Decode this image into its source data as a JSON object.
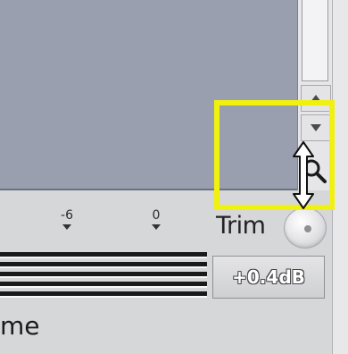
{
  "meter": {
    "tick_labels": [
      "-6",
      "0"
    ]
  },
  "trim": {
    "label": "Trim",
    "value": "+0.4dB"
  },
  "volume": {
    "label_fragment": "me"
  },
  "colors": {
    "highlight": "#f1f10f",
    "track_background": "#9a9fb0"
  },
  "icons": {
    "scroll_up": "triangle-up-icon",
    "scroll_down": "triangle-down-icon",
    "zoom": "magnifier-icon",
    "cursor": "vertical-resize-cursor-icon",
    "knob": "trim-knob-icon"
  }
}
